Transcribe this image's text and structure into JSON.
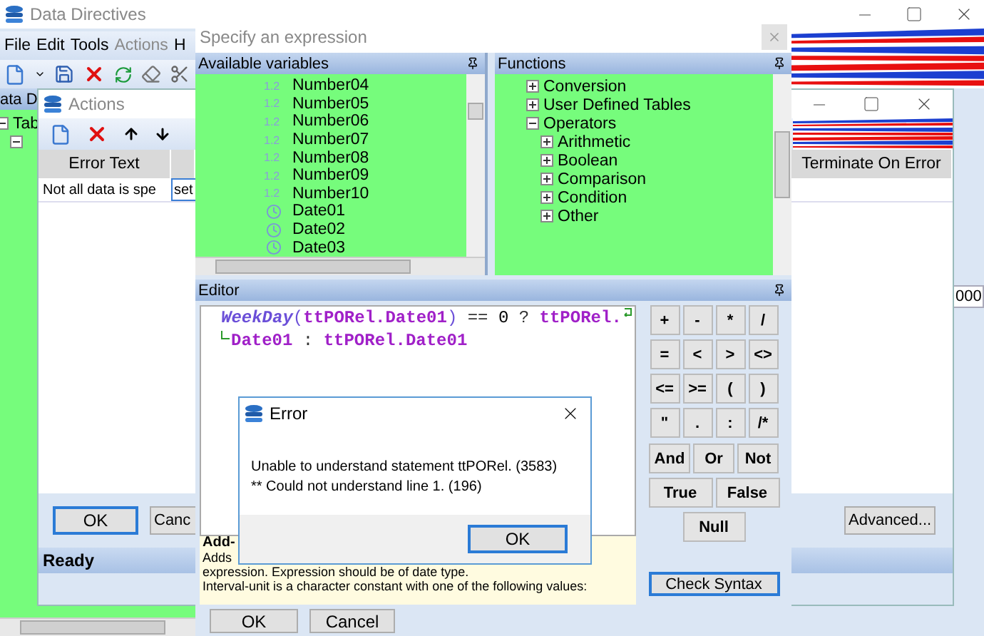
{
  "main": {
    "title": "Data Directives",
    "menu": [
      {
        "label": "File",
        "disabled": false
      },
      {
        "label": "Edit",
        "disabled": false
      },
      {
        "label": "Tools",
        "disabled": false
      },
      {
        "label": "Actions",
        "disabled": true
      },
      {
        "label": "H",
        "disabled": false
      }
    ],
    "panel_title": "ata D",
    "tree": [
      {
        "label": "Tab",
        "expanded": true,
        "children": [
          {
            "expanded": true
          }
        ]
      }
    ],
    "field_value": "000"
  },
  "actions": {
    "title": "Actions",
    "columns": [
      "Error Text",
      "Terminate On Error"
    ],
    "rows": [
      {
        "error_text": "Not all data is spe",
        "editing": "set"
      }
    ],
    "buttons": [
      "OK",
      "Canc"
    ],
    "advanced": "Advanced...",
    "status": "Ready"
  },
  "expression": {
    "title": "Specify an expression",
    "variables_title": "Available variables",
    "variables": [
      {
        "kind": "number",
        "type_label": "1.2",
        "label": "Number04"
      },
      {
        "kind": "number",
        "type_label": "1.2",
        "label": "Number05"
      },
      {
        "kind": "number",
        "type_label": "1.2",
        "label": "Number06"
      },
      {
        "kind": "number",
        "type_label": "1.2",
        "label": "Number07"
      },
      {
        "kind": "number",
        "type_label": "1.2",
        "label": "Number08"
      },
      {
        "kind": "number",
        "type_label": "1.2",
        "label": "Number09"
      },
      {
        "kind": "number",
        "type_label": "1.2",
        "label": "Number10"
      },
      {
        "kind": "date",
        "label": "Date01"
      },
      {
        "kind": "date",
        "label": "Date02"
      },
      {
        "kind": "date",
        "label": "Date03"
      }
    ],
    "functions_title": "Functions",
    "functions": [
      {
        "children": [
          {
            "label": "Conversion",
            "expanded": false
          },
          {
            "label": "User Defined Tables",
            "expanded": false
          }
        ]
      },
      {
        "label": "Operators",
        "expanded": true,
        "children": [
          {
            "label": "Arithmetic",
            "expanded": false
          },
          {
            "label": "Boolean",
            "expanded": false
          },
          {
            "label": "Comparison",
            "expanded": false
          },
          {
            "label": "Condition",
            "expanded": false
          },
          {
            "label": "Other",
            "expanded": false
          }
        ]
      }
    ],
    "editor_title": "Editor",
    "code": [
      {
        "wrapped": true,
        "continuation": false,
        "tokens": [
          {
            "t": "WeekDay",
            "kind": "func"
          },
          {
            "t": "(",
            "kind": "punct"
          },
          {
            "t": "ttPORel.Date01",
            "kind": "ident"
          },
          {
            "t": ")",
            "kind": "punct"
          },
          {
            "t": " == ",
            "kind": "op"
          },
          {
            "t": "0",
            "kind": "num"
          },
          {
            "t": " ? ",
            "kind": "op"
          },
          {
            "t": "ttPORel.",
            "kind": "ident"
          }
        ]
      },
      {
        "wrapped": false,
        "continuation": true,
        "tokens": [
          {
            "t": "Date01",
            "kind": "ident"
          },
          {
            "t": " : ",
            "kind": "op"
          },
          {
            "t": "ttPORel.Date01",
            "kind": "ident"
          }
        ]
      }
    ],
    "operators": [
      [
        "+",
        "-",
        "*",
        "/"
      ],
      [
        "=",
        "<",
        ">",
        "<>"
      ],
      [
        "<=",
        ">=",
        "(",
        ")"
      ],
      [
        "\"",
        ".",
        ":",
        "/*"
      ],
      [
        "And",
        "Or",
        "Not"
      ],
      [
        "True",
        "False"
      ],
      [
        "Null"
      ]
    ],
    "help": {
      "title": "Add-",
      "lines": [
        "Adds",
        "expression. Expression should be of date type.",
        "Interval-unit is a character constant with one of the following values:"
      ]
    },
    "check_syntax": "Check Syntax",
    "buttons": [
      "OK",
      "Cancel"
    ]
  },
  "error": {
    "title": "Error",
    "message": [
      "Unable to understand statement ttPORel. (3583)",
      "** Could not understand line 1. (196)"
    ],
    "button": "OK"
  }
}
